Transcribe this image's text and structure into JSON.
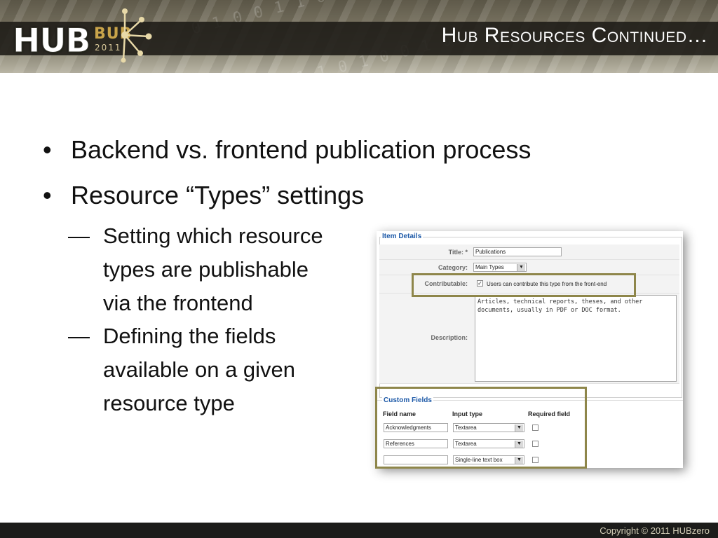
{
  "header": {
    "title": "Hub Resources Continued…",
    "logo": {
      "hub": "HUB",
      "bub": "BUB",
      "year": "2011"
    }
  },
  "bullets": [
    "Backend vs. frontend publication process",
    "Resource “Types” settings"
  ],
  "sub_bullets": [
    [
      "Setting which resource",
      "types are publishable",
      "via the frontend"
    ],
    [
      "Defining the fields",
      "available on a given",
      "resource type"
    ]
  ],
  "bullet_glyph": "•",
  "dash_glyph": "—",
  "form": {
    "item_details_legend": "Item Details",
    "title_label": "Title: *",
    "title_value": "Publications",
    "category_label": "Category:",
    "category_value": "Main Types",
    "contributable_label": "Contributable:",
    "contributable_text": "Users can contribute this type from the front-end",
    "contributable_checked": true,
    "description_label": "Description:",
    "description_value": "Articles, technical reports, theses, and other\ndocuments, usually in PDF or DOC format.",
    "custom_fields_legend": "Custom Fields",
    "columns": [
      "Field name",
      "Input type",
      "Required field"
    ],
    "custom_rows": [
      {
        "name": "Acknowledgments",
        "type": "Textarea",
        "required": false
      },
      {
        "name": "References",
        "type": "Textarea",
        "required": false
      },
      {
        "name": "",
        "type": "Single-line text box",
        "required": false
      }
    ]
  },
  "colors": {
    "highlight": "#8e864a",
    "legend_blue": "#1e5aa8",
    "footer_bg": "#1c1c1a"
  },
  "footer": {
    "copyright": "Copyright  ©  2011  HUBzero"
  }
}
